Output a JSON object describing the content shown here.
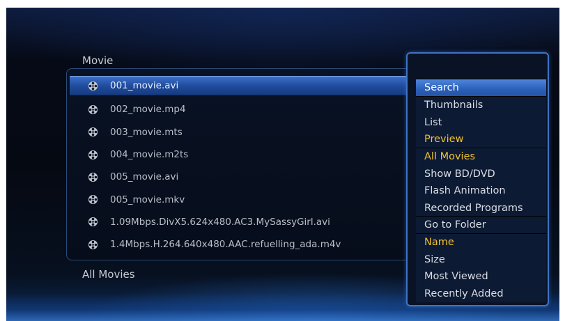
{
  "section_title": "Movie",
  "footer_label": "All Movies",
  "files": [
    {
      "name": "001_movie.avi",
      "icon": "film-reel-icon",
      "selected": true
    },
    {
      "name": "002_movie.mp4",
      "icon": "film-reel-icon"
    },
    {
      "name": "003_movie.mts",
      "icon": "film-reel-icon"
    },
    {
      "name": "004_movie.m2ts",
      "icon": "film-reel-icon"
    },
    {
      "name": "005_movie.avi",
      "icon": "film-reel-icon"
    },
    {
      "name": "005_movie.mkv",
      "icon": "film-reel-icon"
    },
    {
      "name": "1.09Mbps.DivX5.624x480.AC3.MySassyGirl.avi",
      "icon": "film-reel-icon"
    },
    {
      "name": "1.4Mbps.H.264.640x480.AAC.refuelling_ada.m4v",
      "icon": "film-reel-icon"
    }
  ],
  "menu": {
    "search": "Search",
    "view": {
      "thumbnails": "Thumbnails",
      "list": "List",
      "preview": "Preview"
    },
    "filter": {
      "all_movies": "All Movies",
      "show_bd_dvd": "Show BD/DVD",
      "flash_animation": "Flash Animation",
      "recorded_programs": "Recorded Programs"
    },
    "go_to_folder": "Go to Folder",
    "sort": {
      "name": "Name",
      "size": "Size",
      "most_viewed": "Most Viewed",
      "recently_added": "Recently Added"
    }
  },
  "colors": {
    "accent": "#f2c12e",
    "highlight": "#2b5fb8",
    "background": "#050912"
  }
}
